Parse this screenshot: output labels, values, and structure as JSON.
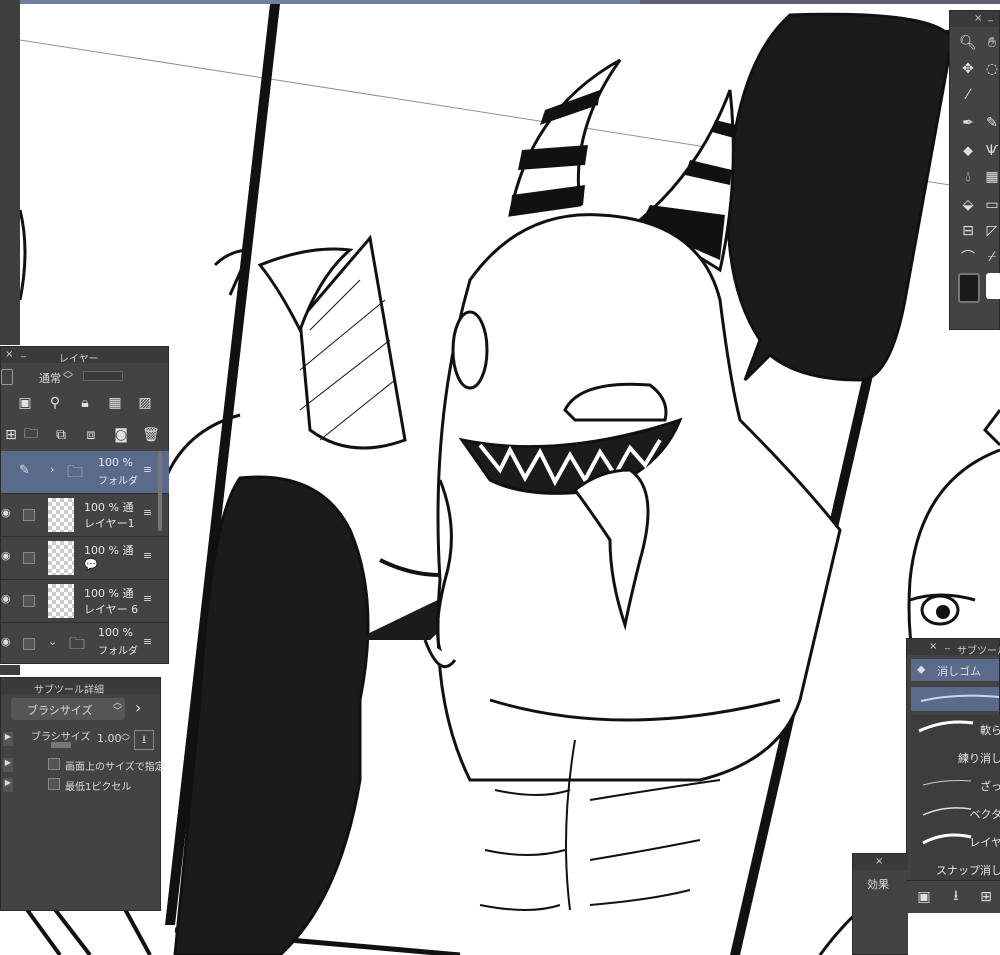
{
  "colors": {
    "panel_bg": "#434343",
    "panel_title": "#3a3a3a",
    "selected": "#5a6a8a",
    "ink": "#1a1a1a"
  },
  "layer_panel": {
    "title": "レイヤー",
    "blend_mode": "通常",
    "layers": [
      {
        "opacity": "100 %",
        "name": "フォルダ",
        "kind": "folder"
      },
      {
        "opacity": "100 % 通",
        "name": "レイヤー1",
        "kind": "raster"
      },
      {
        "opacity": "100 % 通",
        "name": "💬",
        "kind": "raster"
      },
      {
        "opacity": "100 % 通",
        "name": "レイヤー 6",
        "kind": "raster"
      },
      {
        "opacity": "100 %",
        "name": "フォルダ",
        "kind": "folder"
      }
    ]
  },
  "subtool_detail": {
    "title": "サブツール詳細",
    "category": "ブラシサイズ",
    "brush_size_label": "ブラシサイズ",
    "brush_size_value": "1.00",
    "option1": "画面上のサイズで指定",
    "option2": "最低1ピクセル"
  },
  "subtool_panel": {
    "title": "サブツール",
    "tool_name": "消しゴム",
    "brushes": [
      "軟ら",
      "練り消し",
      "ざっ",
      "ベクタ",
      "レイヤ",
      "スナップ消し"
    ]
  },
  "effect_panel": {
    "title": "効果"
  }
}
